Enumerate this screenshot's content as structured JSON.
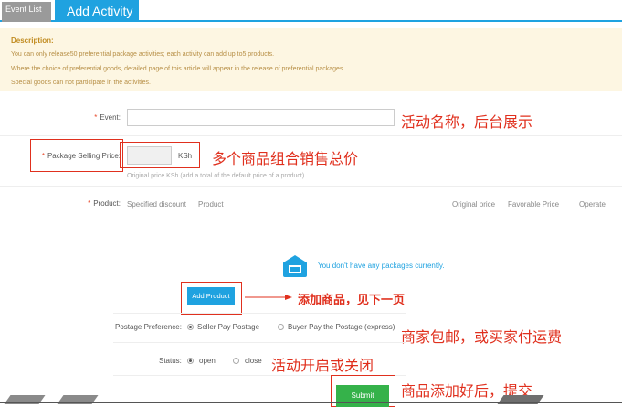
{
  "tabs": {
    "event_list": "Event List",
    "add_activity": "Add Activity"
  },
  "description": {
    "title": "Description:",
    "lines": [
      "You can only release50 preferential package activities; each activity can add up to5 products.",
      "Where the choice of preferential goods, detailed page of this article will appear in the release of preferential packages.",
      "Special goods can not participate in the activities."
    ]
  },
  "form": {
    "event_label": "Event:",
    "event_value": "",
    "event_annotation": "活动名称，后台展示",
    "price_label": "Package Selling Price:",
    "price_value": "",
    "price_unit": "KSh",
    "price_annotation": "多个商品组合销售总价",
    "price_hint": "Original price   KSh (add a total of the default price of a product)",
    "product_label": "Product:",
    "product_columns": {
      "specified_discount": "Specified discount",
      "product": "Product",
      "original_price": "Original price",
      "favorable_price": "Favorable Price",
      "operate": "Operate"
    },
    "empty_message": "You don't have any packages currently.",
    "add_product_button": "Add Product",
    "add_product_annotation": "添加商品，见下一页",
    "postage_label": "Postage Preference:",
    "postage_options": [
      "Seller Pay Postage",
      "Buyer Pay the Postage (express)"
    ],
    "postage_selected": "Seller Pay Postage",
    "postage_annotation": "商家包邮，或买家付运费",
    "status_label": "Status:",
    "status_options": [
      "open",
      "close"
    ],
    "status_selected": "open",
    "status_annotation": "活动开启或关闭",
    "submit_button": "Submit",
    "submit_annotation": "商品添加好后，提交"
  },
  "colors": {
    "accent": "#1fa2e0",
    "annotation_red": "#e0301e",
    "submit_green": "#35b24a",
    "description_bg": "#fdf6e2"
  },
  "icons": {
    "empty_packages": "package-box-icon",
    "arrow": "right-arrow-icon"
  }
}
